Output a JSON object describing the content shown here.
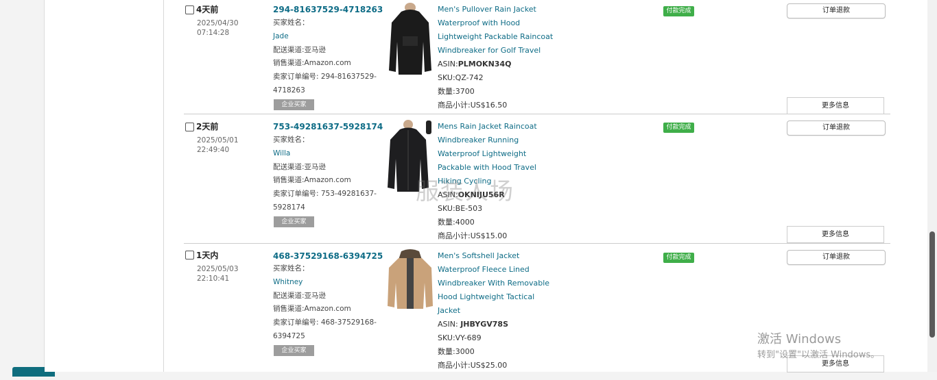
{
  "orders": [
    {
      "age": "4天前",
      "date": "2025/04/30",
      "time": "07:14:28",
      "order_id": "294-81637529-4718263",
      "buyer_label": "买家姓名：",
      "buyer_name": "Jade",
      "delivery": "配送渠道:亚马逊",
      "sales_channel": "销售渠道:Amazon.com",
      "seller_order_label": "卖家订单编号: 294-81637529-",
      "seller_order_tail": "4718263",
      "biz_badge": "企业买家",
      "title_lines": [
        "Men's Pullover Rain Jacket",
        "Waterproof with Hood",
        "Lightweight Packable Raincoat",
        "Windbreaker for Golf Travel"
      ],
      "asin_label": "ASIN:",
      "asin": "PLMOKN34Q",
      "sku": "SKU:QZ-742",
      "qty": "数量:3700",
      "subtotal": "商品小计:US$16.50",
      "status": "付款完成",
      "refund_label": "订单退款",
      "more_label": "更多信息"
    },
    {
      "age": "2天前",
      "date": "2025/05/01",
      "time": "22:49:40",
      "order_id": "753-49281637-5928174",
      "buyer_label": "买家姓名：",
      "buyer_name": "Willa",
      "delivery": "配送渠道:亚马逊",
      "sales_channel": "销售渠道:Amazon.com",
      "seller_order_label": "卖家订单编号: 753-49281637-",
      "seller_order_tail": "5928174",
      "biz_badge": "企业买家",
      "title_lines": [
        "Mens Rain Jacket Raincoat",
        "Windbreaker Running",
        "Waterproof Lightweight",
        "Packable with Hood Travel",
        "Hiking Cycling"
      ],
      "asin_label": "ASIN:",
      "asin": "OKNIJU56R",
      "sku": "SKU:BE-503",
      "qty": "数量:4000",
      "subtotal": "商品小计:US$15.00",
      "status": "付款完成",
      "refund_label": "订单退款",
      "more_label": "更多信息"
    },
    {
      "age": "1天内",
      "date": "2025/05/03",
      "time": "22:10:41",
      "order_id": "468-37529168-6394725",
      "buyer_label": "买家姓名：",
      "buyer_name": "Whitney",
      "delivery": "配送渠道:亚马逊",
      "sales_channel": "销售渠道:Amazon.com",
      "seller_order_label": "卖家订单编号: 468-37529168-",
      "seller_order_tail": "6394725",
      "biz_badge": "企业买家",
      "title_lines": [
        "Men's Softshell Jacket",
        "Waterproof Fleece Lined",
        "Windbreaker With Removable",
        "Hood Lightweight Tactical",
        "Jacket"
      ],
      "asin_label": "ASIN: ",
      "asin": "JHBYGV78S",
      "sku": "SKU:VY-689",
      "qty": "数量:3000",
      "subtotal": "商品小计:US$25.00",
      "status": "付款完成",
      "refund_label": "订单退款",
      "more_label": "更多信息"
    }
  ],
  "watermark": "服装人场",
  "windows_activation": {
    "line1": "激活 Windows",
    "line2": "转到\"设置\"以激活 Windows。"
  },
  "colors": {
    "link": "#0e6c86",
    "status_green": "#3fae49",
    "badge_gray": "#9d9d9d"
  }
}
